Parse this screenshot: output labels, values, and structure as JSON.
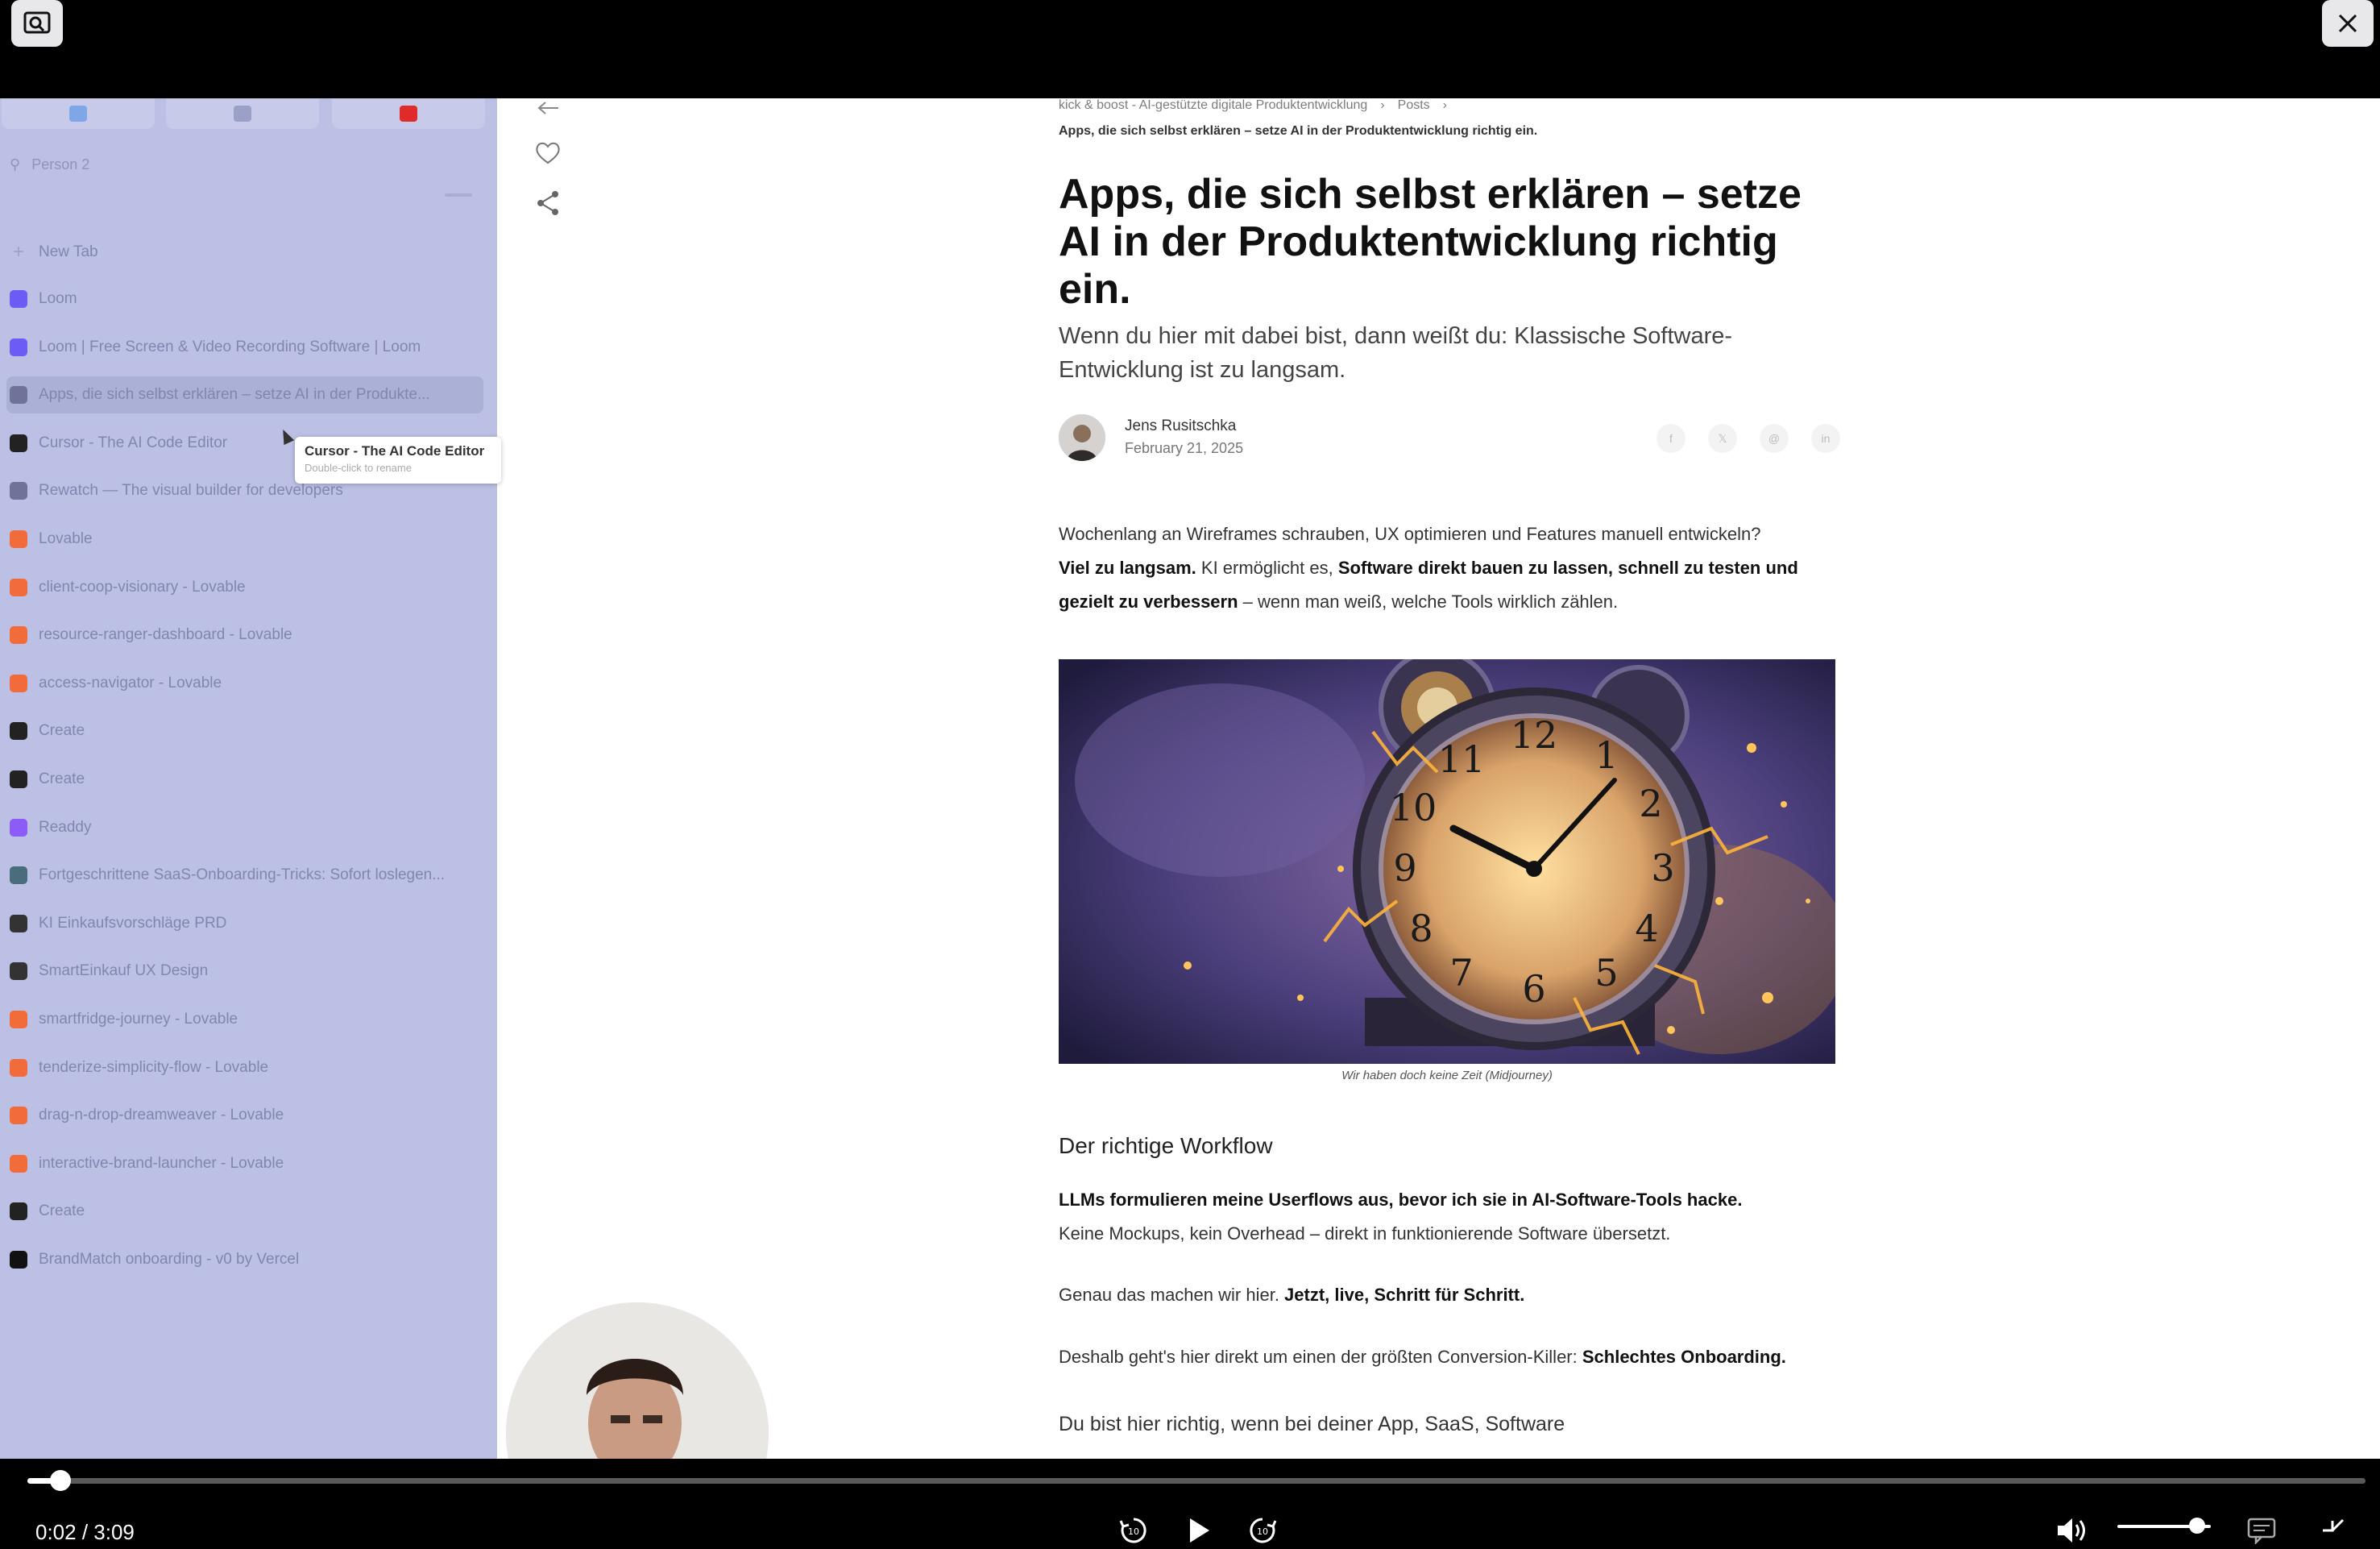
{
  "window": {
    "pip_icon": "picture-in-picture-icon",
    "close_icon": "close-icon"
  },
  "sidebar": {
    "profile": "Person 2",
    "new_tab": "New Tab",
    "tabs": [
      {
        "label": "Loom",
        "icon": "loom-icon",
        "color": "#6b5cf6"
      },
      {
        "label": "Loom | Free Screen & Video Recording Software | Loom",
        "icon": "loom-icon",
        "color": "#6b5cf6"
      },
      {
        "label": "Apps, die sich selbst erklären – setze AI in der Produkte...",
        "icon": "refresh-icon",
        "color": "#6f7399"
      },
      {
        "label": "Cursor - The AI Code Editor",
        "icon": "cursor-app-icon",
        "color": "#222222"
      },
      {
        "label": "Rewatch — The visual builder for developers",
        "icon": "app-icon",
        "color": "#6f7399"
      },
      {
        "label": "Lovable",
        "icon": "lovable-icon",
        "color": "#f26b3a"
      },
      {
        "label": "client-coop-visionary - Lovable",
        "icon": "lovable-icon",
        "color": "#f26b3a"
      },
      {
        "label": "resource-ranger-dashboard - Lovable",
        "icon": "lovable-icon",
        "color": "#f26b3a"
      },
      {
        "label": "access-navigator - Lovable",
        "icon": "lovable-icon",
        "color": "#f26b3a"
      },
      {
        "label": "Create",
        "icon": "create-icon",
        "color": "#222222"
      },
      {
        "label": "Create",
        "icon": "create-icon",
        "color": "#222222"
      },
      {
        "label": "Readdy",
        "icon": "readdy-icon",
        "color": "#8b5cf6"
      },
      {
        "label": "Fortgeschrittene SaaS-Onboarding-Tricks: Sofort loslegen...",
        "icon": "doc-icon",
        "color": "#4a6d7c"
      },
      {
        "label": "KI Einkaufsvorschläge PRD",
        "icon": "openai-icon",
        "color": "#333333"
      },
      {
        "label": "SmartEinkauf UX Design",
        "icon": "openai-icon",
        "color": "#333333"
      },
      {
        "label": "smartfridge-journey - Lovable",
        "icon": "lovable-icon",
        "color": "#f26b3a"
      },
      {
        "label": "tenderize-simplicity-flow - Lovable",
        "icon": "lovable-icon",
        "color": "#f26b3a"
      },
      {
        "label": "drag-n-drop-dreamweaver - Lovable",
        "icon": "lovable-icon",
        "color": "#f26b3a"
      },
      {
        "label": "interactive-brand-launcher - Lovable",
        "icon": "lovable-icon",
        "color": "#f26b3a"
      },
      {
        "label": "Create",
        "icon": "create-icon",
        "color": "#222222"
      },
      {
        "label": "BrandMatch onboarding - v0 by Vercel",
        "icon": "v0-icon",
        "color": "#111111"
      }
    ],
    "tooltip": {
      "title": "Cursor - The AI Code Editor",
      "hint": "Double-click to rename"
    }
  },
  "article": {
    "breadcrumb": [
      "kick & boost - AI-gestützte digitale Produktentwicklung",
      "Posts"
    ],
    "breadcrumb_current": "Apps, die sich selbst erklären – setze AI in der Produktentwicklung richtig ein.",
    "title": "Apps, die sich selbst erklären – setze AI in der Produktentwicklung richtig ein.",
    "subtitle": "Wenn du hier mit dabei bist, dann weißt du: Klassische Software-Entwicklung ist zu langsam.",
    "author": "Jens Rusitschka",
    "date": "February 21, 2025",
    "intro": {
      "t1": "Wochenlang an Wireframes schrauben, UX optimieren und Features manuell entwickeln?",
      "b1": "Viel zu langsam.",
      "t2": " KI ermöglicht es, ",
      "b2": "Software direkt bauen zu lassen, schnell zu testen und gezielt zu verbessern",
      "t3": " – wenn man weiß, welche Tools wirklich zählen."
    },
    "image_caption": "Wir haben doch keine Zeit (Midjourney)",
    "section_heading": "Der richtige Workflow",
    "p1_bold": "LLMs formulieren meine Userflows aus, bevor ich sie in AI-Software-Tools hacke.",
    "p1_text": "Keine Mockups, kein Overhead – direkt in funktionierende Software übersetzt.",
    "p2_text": "Genau das machen wir hier. ",
    "p2_bold": "Jetzt, live, Schritt für Schritt.",
    "p3_text": "Deshalb geht's hier direkt um einen der größten Conversion-Killer: ",
    "p3_bold": "Schlechtes Onboarding.",
    "p4_text": "Du bist hier richtig, wenn bei deiner App, SaaS, Software"
  },
  "player": {
    "time": "0:02 / 3:09",
    "progress": 0.011,
    "volume": 0.85
  }
}
